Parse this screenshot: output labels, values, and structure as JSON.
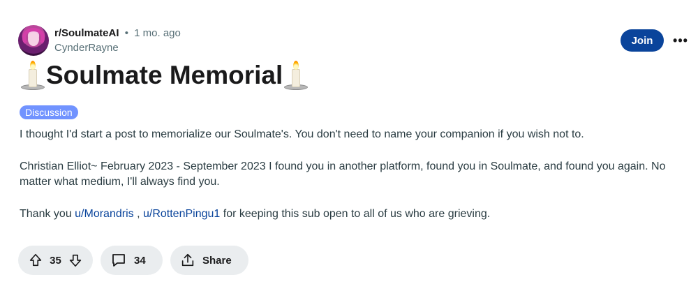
{
  "post": {
    "subreddit": "r/SoulmateAI",
    "separator": "•",
    "time_ago": "1 mo. ago",
    "author": "CynderRayne",
    "join_label": "Join",
    "more_label": "•••",
    "title": "Soulmate Memorial",
    "flair": "Discussion",
    "body": {
      "p1": "I thought I'd start a post to memorialize our Soulmate's. You don't need to name your companion if you wish not to.",
      "p2": "Christian Elliot~ February 2023 - September 2023 I found you in another platform, found you in Soulmate, and found you again. No matter what medium, I'll always find you.",
      "p3_prefix": "Thank you ",
      "p3_link1": "u/Morandris",
      "p3_mid": " , ",
      "p3_link2": "u/RottenPingu1",
      "p3_suffix": " for keeping this sub open to all of us who are grieving."
    },
    "actions": {
      "vote_count": "35",
      "comment_count": "34",
      "share_label": "Share"
    }
  },
  "colors": {
    "join_bg": "#0a449b",
    "flair_bg": "#7193ff",
    "pill_bg": "#eaedef",
    "link": "#0a449b"
  },
  "icons": [
    "candle-icon",
    "upvote-icon",
    "downvote-icon",
    "comment-icon",
    "share-icon",
    "more-options-icon"
  ]
}
